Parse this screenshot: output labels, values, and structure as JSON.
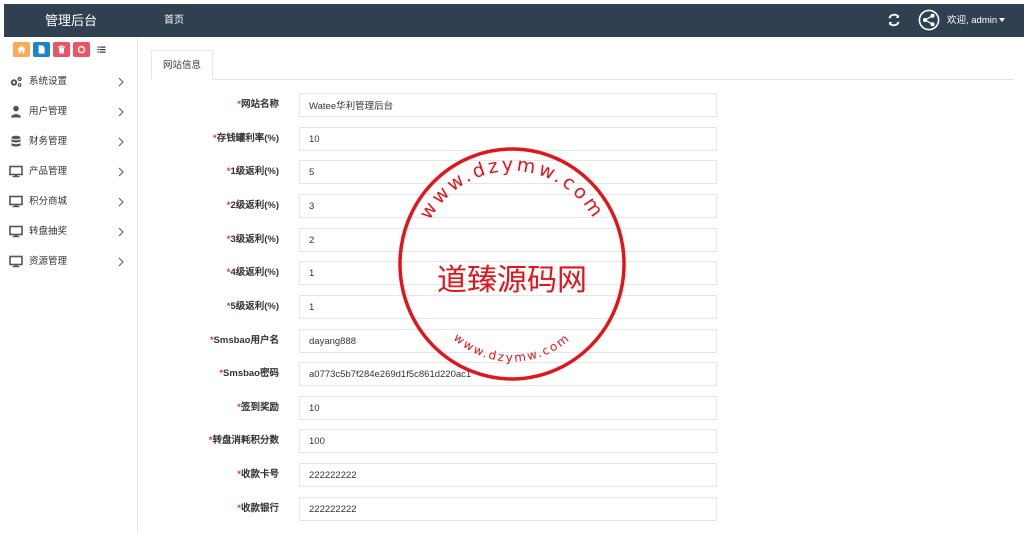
{
  "header": {
    "brand": "管理后台",
    "home_link": "首页",
    "user_label": "欢迎, admin"
  },
  "sidebar": {
    "toolbar": [
      {
        "icon": "home-icon",
        "color": "#f8ac59"
      },
      {
        "icon": "file-icon",
        "color": "#1c84c6"
      },
      {
        "icon": "trash-icon",
        "color": "#ed5565"
      },
      {
        "icon": "recycle-icon",
        "color": "#ed5565"
      },
      {
        "icon": "list-icon",
        "color": "#ffffff"
      }
    ],
    "items": [
      {
        "label": "系统设置",
        "icon": "gears-icon"
      },
      {
        "label": "用户管理",
        "icon": "user-icon"
      },
      {
        "label": "财务管理",
        "icon": "database-icon"
      },
      {
        "label": "产品管理",
        "icon": "desktop-icon"
      },
      {
        "label": "积分商城",
        "icon": "desktop-icon"
      },
      {
        "label": "转盘抽奖",
        "icon": "desktop-icon"
      },
      {
        "label": "资源管理",
        "icon": "desktop-icon"
      }
    ]
  },
  "tabs": [
    {
      "label": "网站信息",
      "active": true
    }
  ],
  "form": {
    "required_mark": "*",
    "fields": [
      {
        "label": "网站名称",
        "value": "Watee华利管理后台"
      },
      {
        "label": "存钱罐利率(%)",
        "value": "10"
      },
      {
        "label": "1级返利(%)",
        "value": "5"
      },
      {
        "label": "2级返利(%)",
        "value": "3"
      },
      {
        "label": "3级返利(%)",
        "value": "2"
      },
      {
        "label": "4级返利(%)",
        "value": "1"
      },
      {
        "label": "5级返利(%)",
        "value": "1"
      },
      {
        "label": "Smsbao用户名",
        "value": "dayang888"
      },
      {
        "label": "Smsbao密码",
        "value": "a0773c5b7f284e269d1f5c861d220ac1"
      },
      {
        "label": "签到奖励",
        "value": "10"
      },
      {
        "label": "转盘消耗积分数",
        "value": "100"
      },
      {
        "label": "收款卡号",
        "value": "222222222"
      },
      {
        "label": "收款银行",
        "value": "222222222"
      }
    ]
  },
  "watermark": {
    "center_text": "道臻源码网",
    "arc_top": "www.dzymw.com",
    "arc_bottom": "www.dzymw.com",
    "color": "#e0161c"
  }
}
